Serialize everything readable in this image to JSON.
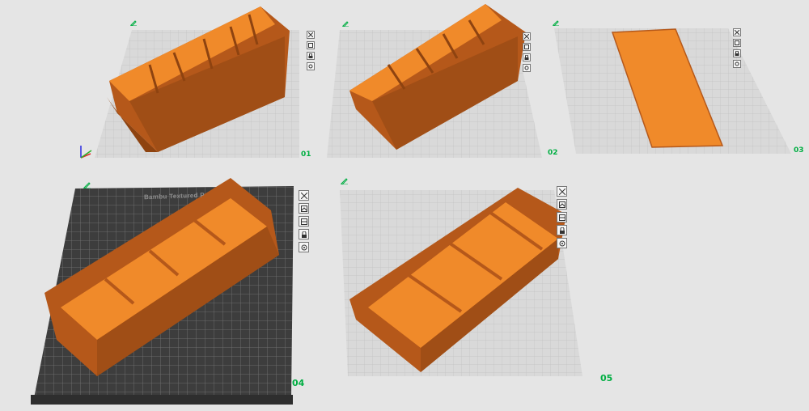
{
  "plates": [
    {
      "number": "01",
      "tools": [
        "close-icon",
        "arrange-icon",
        "lock-icon",
        "settings-icon"
      ]
    },
    {
      "number": "02",
      "tools": [
        "close-icon",
        "arrange-icon",
        "lock-icon",
        "settings-icon"
      ]
    },
    {
      "number": "03",
      "tools": [
        "close-icon",
        "arrange-icon",
        "lock-icon",
        "settings-icon"
      ]
    },
    {
      "number": "04",
      "bed_label": "Bambu Textured P",
      "tools": [
        "close-icon",
        "arrange-icon",
        "orient-icon",
        "lock-icon",
        "settings-icon"
      ]
    },
    {
      "number": "05",
      "tools": [
        "close-icon",
        "arrange-icon",
        "orient-icon",
        "lock-icon",
        "settings-icon"
      ]
    }
  ],
  "colors": {
    "background": "#e5e5e5",
    "grid_plate": "#d6d6d6",
    "grid_line": "#bfbfbf",
    "model_top": "#f08a2a",
    "model_side": "#b5581a",
    "model_dark": "#8e4310",
    "textured_plate": "#3a3a3a",
    "plate_number": "#00ae42"
  }
}
